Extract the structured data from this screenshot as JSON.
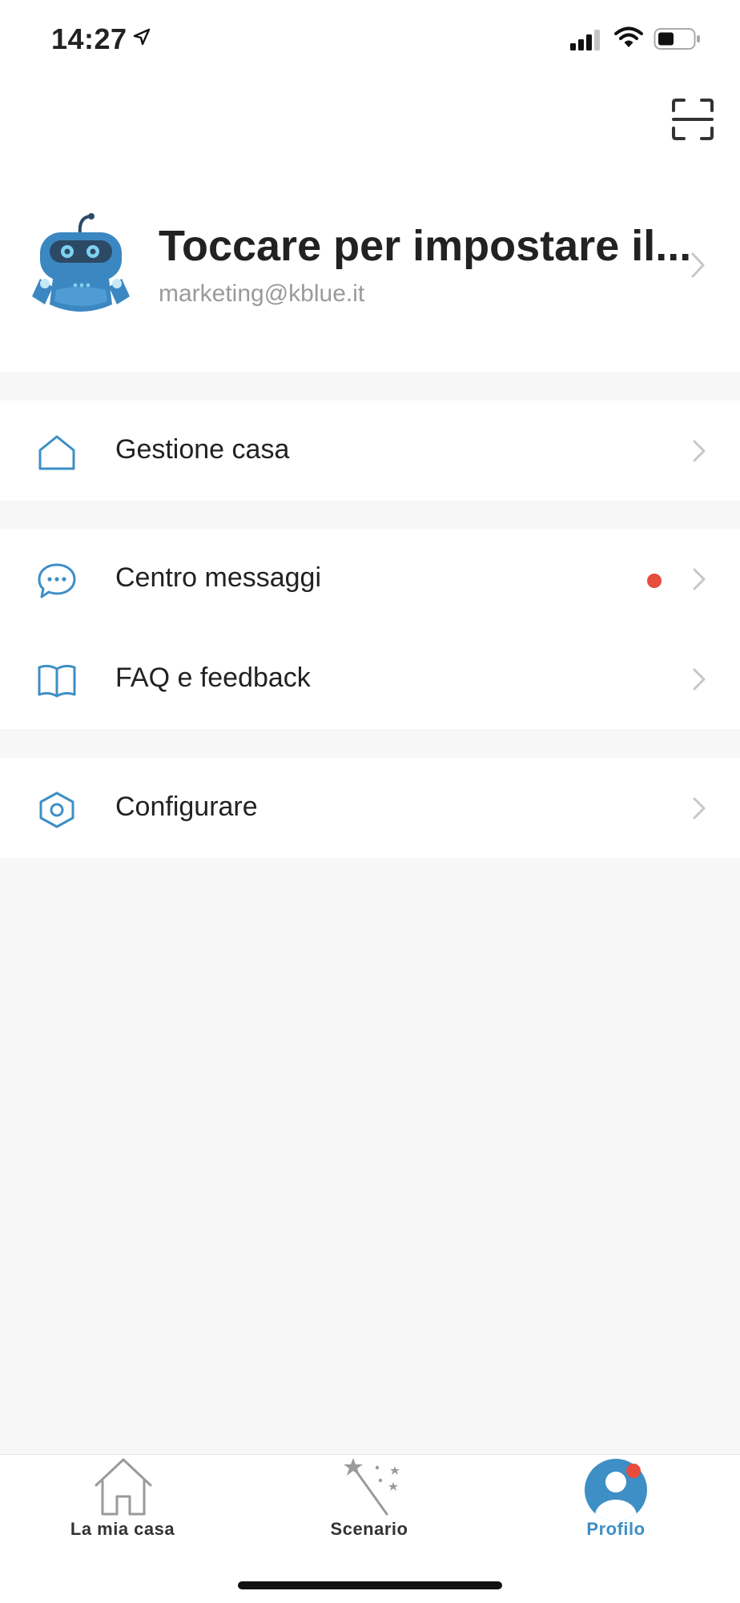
{
  "status_bar": {
    "time": "14:27"
  },
  "profile": {
    "name": "Toccare per impostare il...",
    "email": "marketing@kblue.it"
  },
  "menu": {
    "home_management": "Gestione casa",
    "message_center": "Centro messaggi",
    "faq_feedback": "FAQ e feedback",
    "configure": "Configurare"
  },
  "tabs": [
    {
      "label": "La mia casa",
      "active": false
    },
    {
      "label": "Scenario",
      "active": false
    },
    {
      "label": "Profilo",
      "active": true
    }
  ],
  "colors": {
    "accent": "#3d8fc6",
    "badge": "#e74c3c",
    "text": "#222222",
    "muted": "#9a9a9a",
    "background": "#f7f7f7"
  }
}
